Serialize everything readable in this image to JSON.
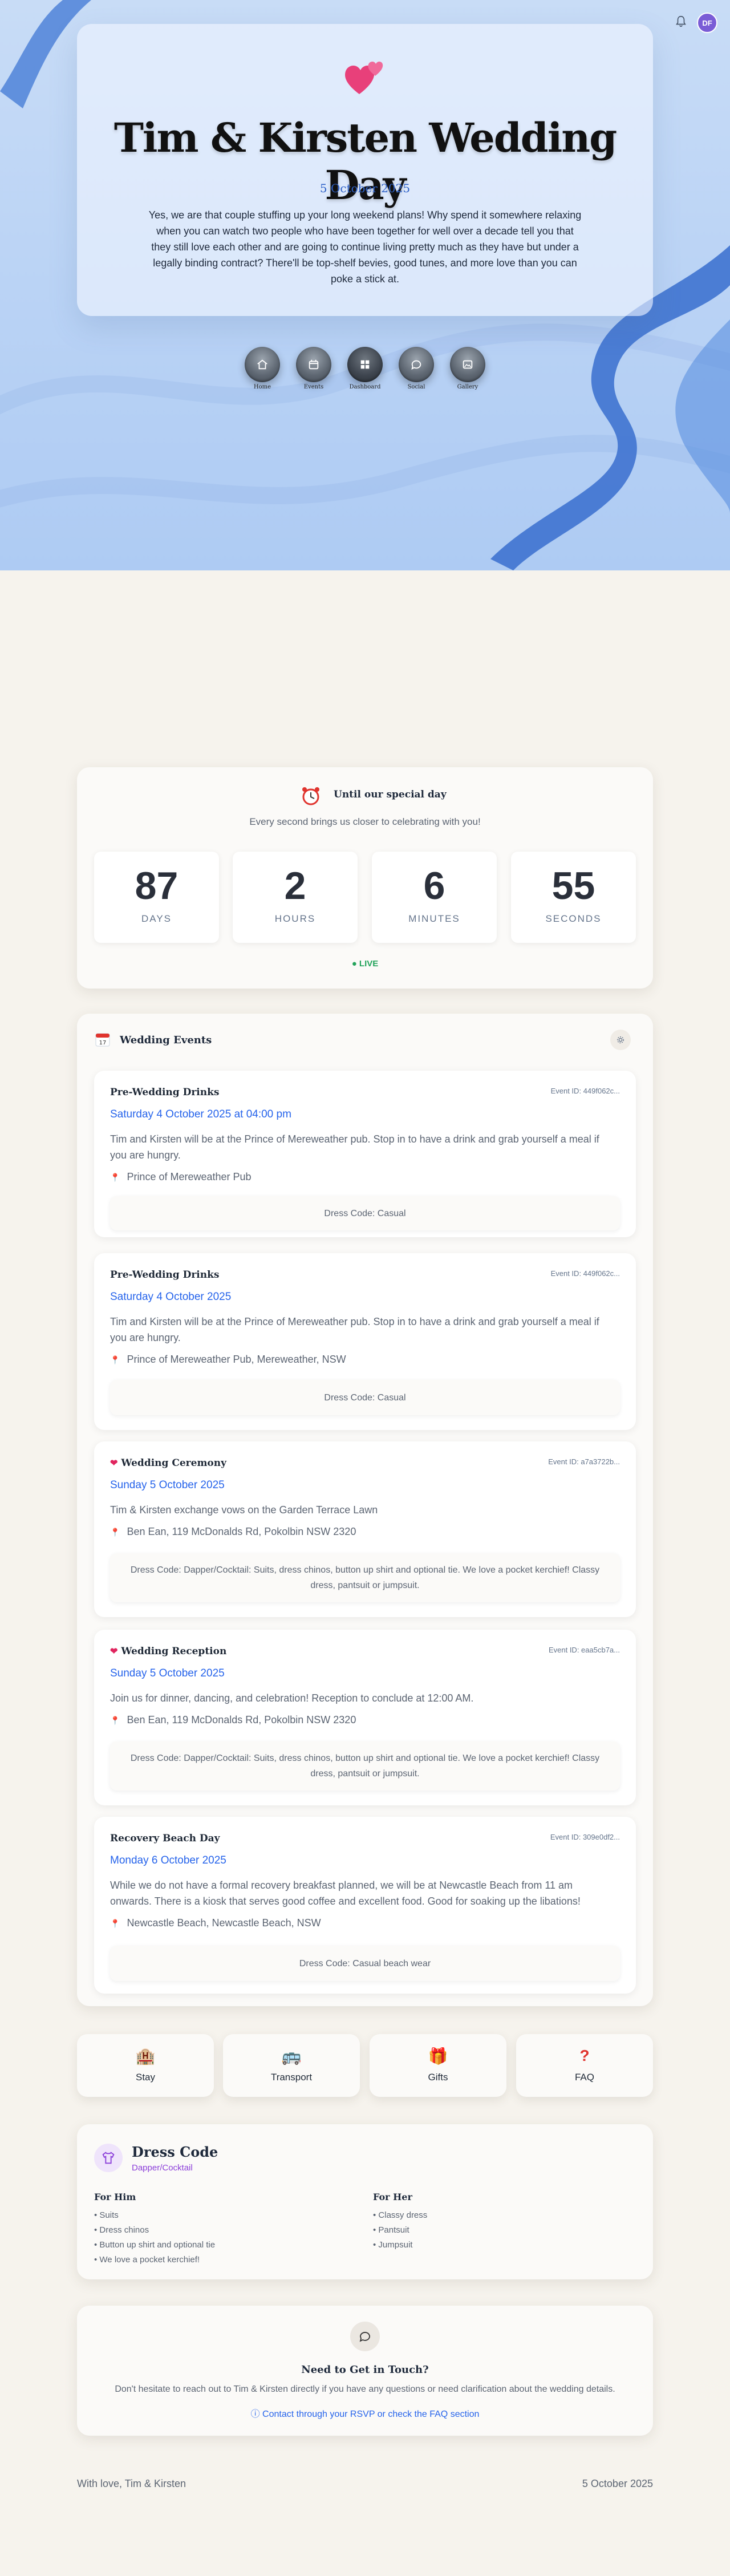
{
  "topbar": {
    "avatar_initials": "DF",
    "bell_icon": "bell-icon"
  },
  "hero": {
    "title": "Tim & Kirsten Wedding Day",
    "date": "5 October 2025",
    "description": "Yes, we are that couple stuffing up your long weekend plans! Why spend it somewhere relaxing when you can watch two people who have been together for well over a decade tell you that they still love each other and are going to continue living pretty much as they have but under a legally binding contract? There'll be top-shelf bevies, good tunes, and more love than you can poke a stick at."
  },
  "nav": [
    {
      "label": "Home",
      "icon": "home-icon"
    },
    {
      "label": "Events",
      "icon": "calendar-icon"
    },
    {
      "label": "Dashboard",
      "icon": "grid-icon"
    },
    {
      "label": "Social",
      "icon": "chat-icon"
    },
    {
      "label": "Gallery",
      "icon": "image-icon"
    }
  ],
  "countdown": {
    "title": "Until our special day",
    "subtitle": "Every second brings us closer to celebrating with you!",
    "units": [
      {
        "value": "87",
        "label": "DAYS"
      },
      {
        "value": "2",
        "label": "HOURS"
      },
      {
        "value": "6",
        "label": "MINUTES"
      },
      {
        "value": "55",
        "label": "SECONDS"
      }
    ],
    "live": "● LIVE"
  },
  "events_section": {
    "title": "Wedding Events",
    "events": [
      {
        "title": "Pre-Wedding Drinks",
        "event_id": "Event ID: 449f062c...",
        "date": "Saturday 4 October 2025 at 04:00 pm",
        "description": "Tim and Kirsten will be at the Prince of Mereweather pub. Stop in to have a drink and grab yourself a meal if you are hungry.",
        "location": "Prince of Mereweather Pub",
        "dress": "Dress Code: Casual",
        "hearted": false
      },
      {
        "title": "Pre-Wedding Drinks",
        "event_id": "Event ID: 449f062c...",
        "date": "Saturday 4 October 2025",
        "description": "Tim and Kirsten will be at the Prince of Mereweather pub. Stop in to have a drink and grab yourself a meal if you are hungry.",
        "location": "Prince of Mereweather Pub, Mereweather, NSW",
        "dress": "Dress Code: Casual",
        "hearted": false
      },
      {
        "title": "Wedding Ceremony",
        "event_id": "Event ID: a7a3722b...",
        "date": "Sunday 5 October 2025",
        "description": "Tim & Kirsten exchange vows on the Garden Terrace Lawn",
        "location": "Ben Ean, 119 McDonalds Rd, Pokolbin NSW 2320",
        "dress": "Dress Code: Dapper/Cocktail: Suits, dress chinos, button up shirt and optional tie. We love a pocket kerchief! Classy dress, pantsuit or jumpsuit.",
        "hearted": true
      },
      {
        "title": "Wedding Reception",
        "event_id": "Event ID: eaa5cb7a...",
        "date": "Sunday 5 October 2025",
        "description": "Join us for dinner, dancing, and celebration! Reception to conclude at 12:00 AM.",
        "location": "Ben Ean, 119 McDonalds Rd, Pokolbin NSW 2320",
        "dress": "Dress Code: Dapper/Cocktail: Suits, dress chinos, button up shirt and optional tie. We love a pocket kerchief! Classy dress, pantsuit or jumpsuit.",
        "hearted": true
      },
      {
        "title": "Recovery Beach Day",
        "event_id": "Event ID: 309e0df2...",
        "date": "Monday 6 October 2025",
        "description": "While we do not have a formal recovery breakfast planned, we will be at Newcastle Beach from 11 am onwards. There is a kiosk that serves good coffee and excellent food. Good for soaking up the libations!",
        "location": "Newcastle Beach, Newcastle Beach, NSW",
        "dress": "Dress Code: Casual beach wear",
        "hearted": false
      }
    ]
  },
  "quick_links": [
    {
      "label": "Stay",
      "icon": "hotel-icon"
    },
    {
      "label": "Transport",
      "icon": "bus-icon"
    },
    {
      "label": "Gifts",
      "icon": "gift-icon"
    },
    {
      "label": "FAQ",
      "icon": "question-icon"
    }
  ],
  "dress_code": {
    "title": "Dress Code",
    "subtitle": "Dapper/Cocktail",
    "him": {
      "heading": "For Him",
      "items": [
        "Suits",
        "Dress chinos",
        "Button up shirt and optional tie",
        "We love a pocket kerchief!"
      ]
    },
    "her": {
      "heading": "For Her",
      "items": [
        "Classy dress",
        "Pantsuit",
        "Jumpsuit"
      ]
    }
  },
  "contact": {
    "title": "Need to Get in Touch?",
    "description": "Don't hesitate to reach out to Tim & Kirsten directly if you have any questions or need clarification about the wedding details.",
    "link": "Contact through your RSVP or check the FAQ section"
  },
  "footer": {
    "left": "With love, Tim & Kirsten",
    "right": "5 October 2025"
  },
  "colors": {
    "accent": "#2563eb",
    "hero_bg": "#bad3f5",
    "page_bg": "#f6f3ed",
    "heart": "#e0245e",
    "live": "#22a35a"
  }
}
